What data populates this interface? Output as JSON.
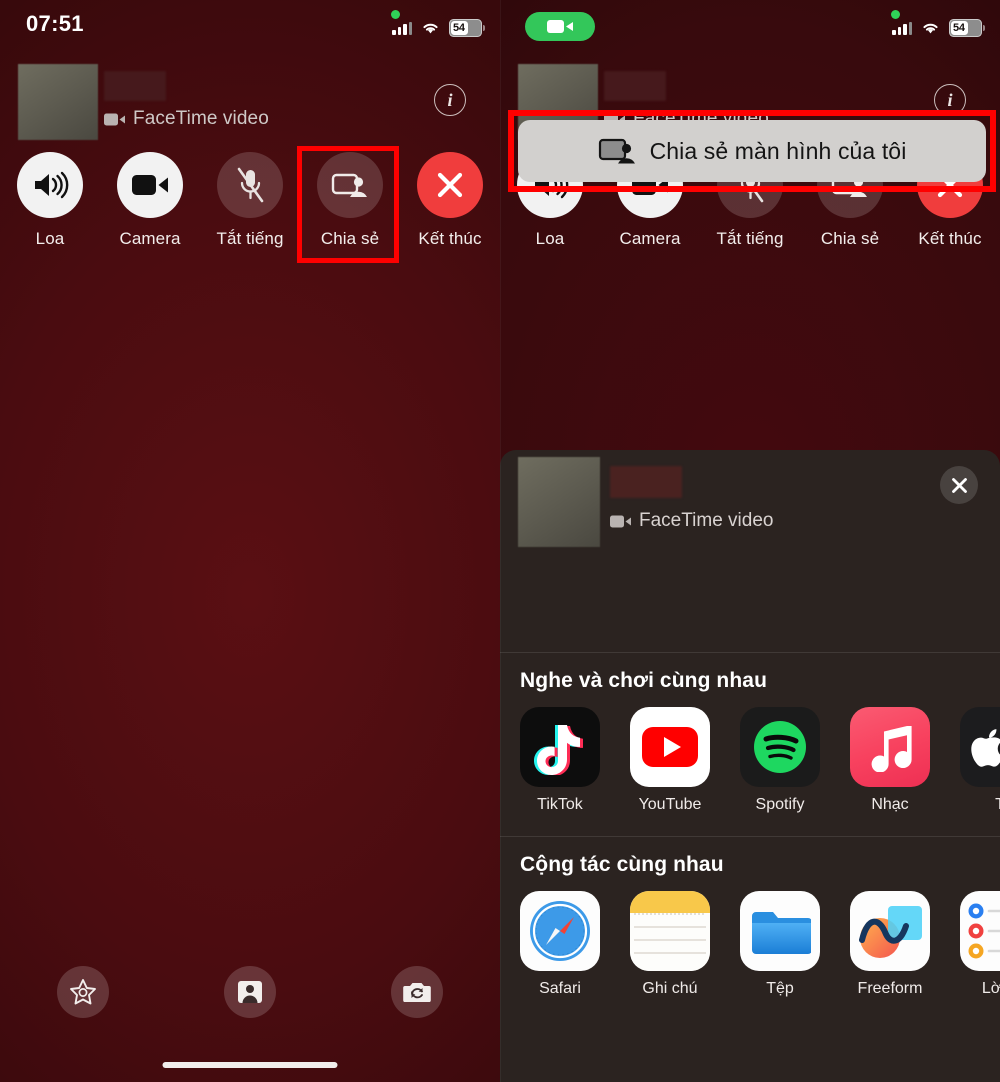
{
  "left_panel": {
    "status_bar": {
      "time": "07:51",
      "battery_level": "54",
      "signal_icon": "cellular-bars-icon",
      "wifi_icon": "wifi-icon",
      "recording_dot_icon": "green-recording-dot-icon"
    },
    "call_header": {
      "app_label": "FaceTime video",
      "video_icon": "video-camera-icon",
      "info_icon": "info-circle-icon"
    },
    "controls": [
      {
        "label": "Loa",
        "icon": "speaker-waves-icon",
        "state": "on"
      },
      {
        "label": "Camera",
        "icon": "video-camera-icon",
        "state": "on"
      },
      {
        "label": "Tắt tiếng",
        "icon": "microphone-slash-icon",
        "state": "off"
      },
      {
        "label": "Chia sẻ",
        "icon": "screen-share-icon",
        "state": "off"
      },
      {
        "label": "Kết thúc",
        "icon": "close-x-icon",
        "state": "end"
      }
    ],
    "bottom_controls": [
      {
        "icon": "effects-star-icon"
      },
      {
        "icon": "person-portrait-icon"
      },
      {
        "icon": "camera-flip-icon"
      }
    ],
    "highlight_target": "Chia sẻ"
  },
  "right_panel": {
    "status_bar": {
      "screen_recording_pill_icon": "green-video-pill-icon",
      "battery_level": "54",
      "signal_icon": "cellular-bars-icon",
      "wifi_icon": "wifi-icon",
      "recording_dot_icon": "green-recording-dot-icon"
    },
    "call_header": {
      "app_label": "FaceTime video",
      "video_icon": "video-camera-icon",
      "info_icon": "info-circle-icon"
    },
    "controls": [
      {
        "label": "Loa",
        "icon": "speaker-waves-icon",
        "state": "on"
      },
      {
        "label": "Camera",
        "icon": "video-camera-icon",
        "state": "on"
      },
      {
        "label": "Tắt tiếng",
        "icon": "microphone-slash-icon",
        "state": "off"
      },
      {
        "label": "Chia sẻ",
        "icon": "screen-share-icon",
        "state": "off"
      },
      {
        "label": "Kết thúc",
        "icon": "close-x-icon",
        "state": "end"
      }
    ],
    "share_sheet": {
      "header": {
        "app_label": "FaceTime video",
        "video_icon": "video-camera-icon",
        "close_icon": "close-x-icon"
      },
      "share_screen_button": {
        "label": "Chia sẻ màn hình của tôi",
        "icon": "screen-share-icon"
      },
      "sections": [
        {
          "title": "Nghe và chơi cùng nhau",
          "apps": [
            {
              "label": "TikTok",
              "icon": "tiktok-icon"
            },
            {
              "label": "YouTube",
              "icon": "youtube-icon"
            },
            {
              "label": "Spotify",
              "icon": "spotify-icon"
            },
            {
              "label": "Nhạc",
              "icon": "apple-music-icon"
            },
            {
              "label": "T",
              "icon": "apple-tv-icon"
            }
          ]
        },
        {
          "title": "Cộng tác cùng nhau",
          "apps": [
            {
              "label": "Safari",
              "icon": "safari-icon"
            },
            {
              "label": "Ghi chú",
              "icon": "notes-icon"
            },
            {
              "label": "Tệp",
              "icon": "files-icon"
            },
            {
              "label": "Freeform",
              "icon": "freeform-icon"
            },
            {
              "label": "Lời n",
              "icon": "reminders-icon"
            }
          ]
        }
      ]
    },
    "highlight_target": "Chia sẻ màn hình của tôi"
  },
  "colors": {
    "highlight": "#ff0000",
    "end_call": "#f03d3d",
    "recording_green": "#33c75a",
    "sheet_background": "#2b2320"
  }
}
